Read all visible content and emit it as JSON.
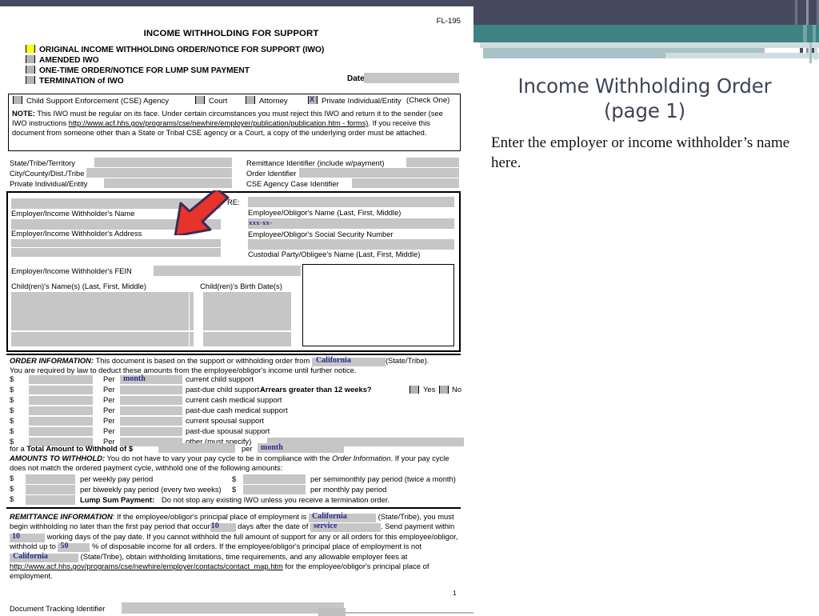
{
  "slide": {
    "title_line1": "Income Withholding Order",
    "title_line2": "(page 1)",
    "body": "Enter the employer or income withholder’s name here.",
    "banner_dark": "#474a5e",
    "banner_teal": "#3e8284",
    "banner_light": "#a8c2c8",
    "banner_pale": "#cfdde0"
  },
  "form": {
    "form_number": "FL-195",
    "main_title": "INCOME WITHHOLDING FOR SUPPORT",
    "type_options": [
      "ORIGINAL INCOME WITHHOLDING ORDER/NOTICE FOR SUPPORT (IWO)",
      "AMENDED IWO",
      "ONE-TIME ORDER/NOTICE FOR LUMP SUM PAYMENT",
      "TERMINATION of IWO"
    ],
    "date_label": "Date:",
    "date_value": "",
    "sender_options": [
      "Child Support Enforcement (CSE) Agency",
      "Court",
      "Attorney",
      "Private Individual/Entity"
    ],
    "check_one": "(Check One)",
    "note_label": "NOTE:",
    "note_text_1": " This IWO must be regular on its face. Under certain circumstances you must reject this IWO and return it to the sender (see IWO instructions ",
    "note_link": "http://www.acf.hhs.gov/programs/cse/newhire/employer/publication/publication.htm - forms)",
    "note_text_2": ". If you receive this document from someone other than a State or Tribal CSE agency or a Court, a copy of the underlying order must be attached.",
    "ids_left": [
      "State/Tribe/Territory",
      "City/County/Dist./Tribe",
      "Private Individual/Entity"
    ],
    "ids_right": [
      "Remittance Identifier (include w/payment)",
      "Order Identifier",
      "CSE Agency Case Identifier"
    ],
    "employer_name_label": "Employer/Income Withholder's Name",
    "employer_address_label": "Employer/Income Withholder's Address",
    "employer_fein_label": "Employer/Income Withholder's FEIN",
    "re_label": "RE:",
    "employee_name_label": "Employee/Obligor's Name (Last, First, Middle)",
    "ssn_mask": "xxx-xx-",
    "ssn_label": "Employee/Obligor's Social Security Number",
    "custodial_label": "Custodial Party/Obligee's Name (Last, First, Middle)",
    "children_names_label": "Child(ren)'s Name(s) (Last, First, Middle)",
    "children_dob_label": "Child(ren)'s Birth Date(s)",
    "order_info_label": "ORDER INFORMATION:",
    "order_info_text": " This document is based on the support or withholding order from ",
    "order_state": "California",
    "state_tribe_paren": "(State/Tribe).",
    "order_info_text2": "You are required by law to deduct these amounts from the employee/obligor's income until further notice.",
    "amount_rows": [
      {
        "per_value": "month",
        "desc": "current child support"
      },
      {
        "per_value": "",
        "desc": "past-due child support -"
      },
      {
        "per_value": "",
        "desc": "current cash medical support"
      },
      {
        "per_value": "",
        "desc": "past-due cash medical support"
      },
      {
        "per_value": "",
        "desc": "current spousal support"
      },
      {
        "per_value": "",
        "desc": "past-due spousal support"
      },
      {
        "per_value": "",
        "desc": "other (must specify)"
      }
    ],
    "per_label": "Per",
    "dollar_sign": "$",
    "arrears_question": "Arrears greater than 12 weeks?",
    "arrears_yes": "Yes",
    "arrears_no": "No",
    "total_prefix": "for a ",
    "total_bold": "Total Amount to Withhold",
    "total_of": " of $",
    "total_per": "per",
    "total_per_value": "month",
    "amounts_label": "AMOUNTS TO WITHHOLD:",
    "amounts_text1": " You do not have to vary your pay cycle to be in compliance with the ",
    "amounts_italic": "Order Information",
    "amounts_text2": ". If your pay cycle does not match the ordered payment cycle, withhold one of the following amounts:",
    "pay_periods": [
      "per weekly pay period",
      "per semimonthly pay period (twice a month)",
      "per biweekly pay period (every two weeks)",
      "per monthly pay period"
    ],
    "lump_sum_label": "Lump Sum Payment:",
    "lump_sum_text": " Do not stop any existing IWO unless you receive a termination order.",
    "remit_label": "REMITTANCE INFORMATION",
    "remit_t1": ": If the employee/obligor's principal place of employment is ",
    "remit_state": "California",
    "remit_t2": " (State/Tribe), you must begin withholding no later than the first pay period that occur",
    "remit_days": "10",
    "remit_t3": " days after the date of ",
    "remit_service": "service",
    "remit_t4": ". Send payment within ",
    "remit_days2": "10",
    "remit_t5": " working days of the pay date. If you cannot withhold the full amount of support for any or all orders for this employee/obligor, withhold up to ",
    "remit_pct": "50",
    "remit_t6": " % of disposable income for all orders. If the employee/obligor's principal place of employment is not ",
    "remit_state2": "California",
    "remit_t7": " (State/Tribe), obtain withholding limitations, time requirements, and any allowable employer fees at ",
    "remit_link": "http://www.acf.hhs.gov/programs/cse/newhire/employer/contacts/contact_map.htm",
    "remit_t8": " for the employee/obligor's principal place of employment.",
    "page_number": "1",
    "doc_tracking_label": "Document Tracking Identifier"
  }
}
